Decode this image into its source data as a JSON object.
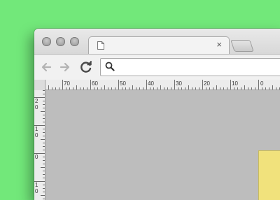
{
  "browser": {
    "tab": {
      "title": "",
      "close_glyph": "×"
    },
    "address_bar": {
      "value": "",
      "placeholder": ""
    }
  },
  "ruler": {
    "top_labels": [
      "70",
      "60",
      "50",
      "40",
      "30",
      "20",
      "10",
      "0"
    ],
    "left_labels": [
      "2 0",
      "1 0",
      "0",
      "1 0"
    ]
  },
  "colors": {
    "desktop": "#72e87a",
    "canvas": "#bdbdbd",
    "artboard": "#f1e27c"
  }
}
